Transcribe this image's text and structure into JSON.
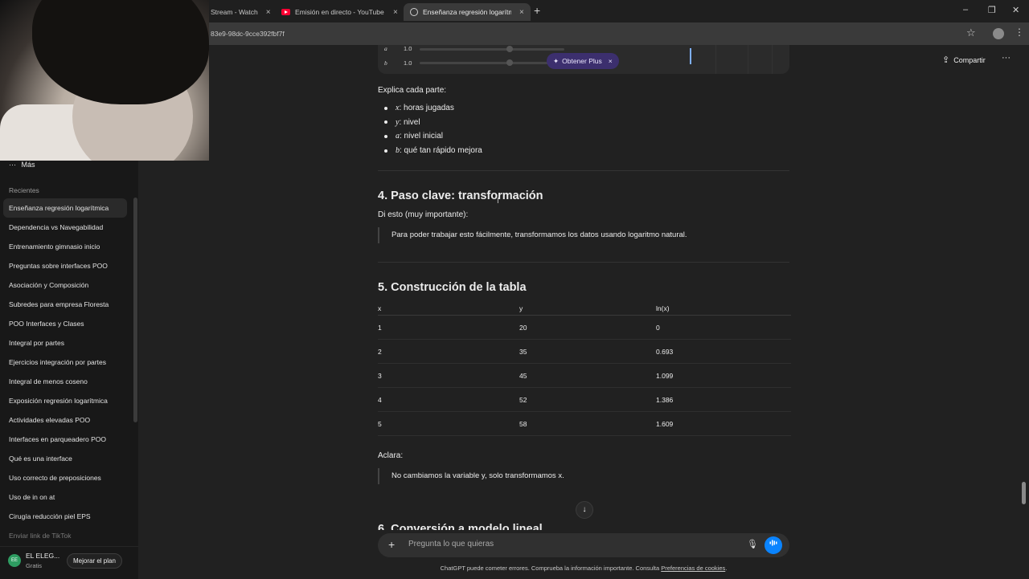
{
  "browser": {
    "tabs": [
      {
        "label": "Stream - Watch",
        "close": "×"
      },
      {
        "label": "Emisión en directo - YouTube S",
        "close": "×"
      },
      {
        "label": "Enseñanza regresión logarítmi",
        "close": "×"
      }
    ],
    "new_tab": "+",
    "window_controls": {
      "minimize": "–",
      "maximize": "❐",
      "close": "✕"
    },
    "url": "83e9-98dc-9cce392fbf7f",
    "bookmark_icon": "☆",
    "menu_icon": "⋮"
  },
  "sidebar": {
    "more_label": "Más",
    "more_icon": "···",
    "recents_heading": "Recientes",
    "chats": [
      "Enseñanza regresión logarítmica",
      "Dependencia vs Navegabilidad",
      "Entrenamiento gimnasio inicio",
      "Preguntas sobre interfaces POO",
      "Asociación y Composición",
      "Subredes para empresa Floresta",
      "POO Interfaces y Clases",
      "Integral por partes",
      "Ejercicios integración por partes",
      "Integral de menos coseno",
      "Exposición regresión logarítmica",
      "Actividades elevadas POO",
      "Interfaces en parqueadero POO",
      "Qué es una interface",
      "Uso correcto de preposiciones",
      "Uso de in on at",
      "Cirugía reducción piel EPS",
      "Enviar link de TikTok"
    ],
    "user": {
      "initials": "EE",
      "name": "EL ELEG...",
      "plan": "Gratis",
      "upgrade_label": "Mejorar el plan"
    }
  },
  "header": {
    "share_label": "Compartir",
    "share_icon": "⇪",
    "options_icon": "···"
  },
  "canvas": {
    "params": [
      {
        "name": "a",
        "value": "1.0"
      },
      {
        "name": "b",
        "value": "1.0"
      }
    ],
    "upsell_label": "Obtener Plus",
    "upsell_icon": "✦",
    "upsell_close": "×"
  },
  "content": {
    "explain_intro": "Explica cada parte:",
    "parts": [
      {
        "var": "x",
        "text": ": horas jugadas"
      },
      {
        "var": "y",
        "text": ": nivel"
      },
      {
        "var": "a",
        "text": ": nivel inicial"
      },
      {
        "var": "b",
        "text": ": qué tan rápido mejora"
      }
    ],
    "section4_title": "4. Paso clave: transformación",
    "section4_intro": "Di esto (muy importante):",
    "section4_quote": "Para poder trabajar esto fácilmente, transformamos los datos usando logaritmo natural.",
    "section5_title": "5. Construcción de la tabla",
    "table": {
      "headers": [
        "x",
        "y",
        "ln(x)"
      ],
      "rows": [
        [
          "1",
          "20",
          "0"
        ],
        [
          "2",
          "35",
          "0.693"
        ],
        [
          "3",
          "45",
          "1.099"
        ],
        [
          "4",
          "52",
          "1.386"
        ],
        [
          "5",
          "58",
          "1.609"
        ]
      ]
    },
    "clarify_intro": "Aclara:",
    "clarify_quote": "No cambiamos la variable y, solo transformamos x.",
    "section6_title": "6. Conversión a modelo lineal",
    "scroll_down_icon": "↓"
  },
  "composer": {
    "placeholder": "Pregunta lo que quieras",
    "plus_icon": "+",
    "mic_icon": "🎙",
    "voice_icon": "▮▮▮"
  },
  "footer": {
    "disclaimer": "ChatGPT puede cometer errores. Comprueba la información importante. Consulta ",
    "link": "Preferencias de cookies",
    "end": "."
  }
}
